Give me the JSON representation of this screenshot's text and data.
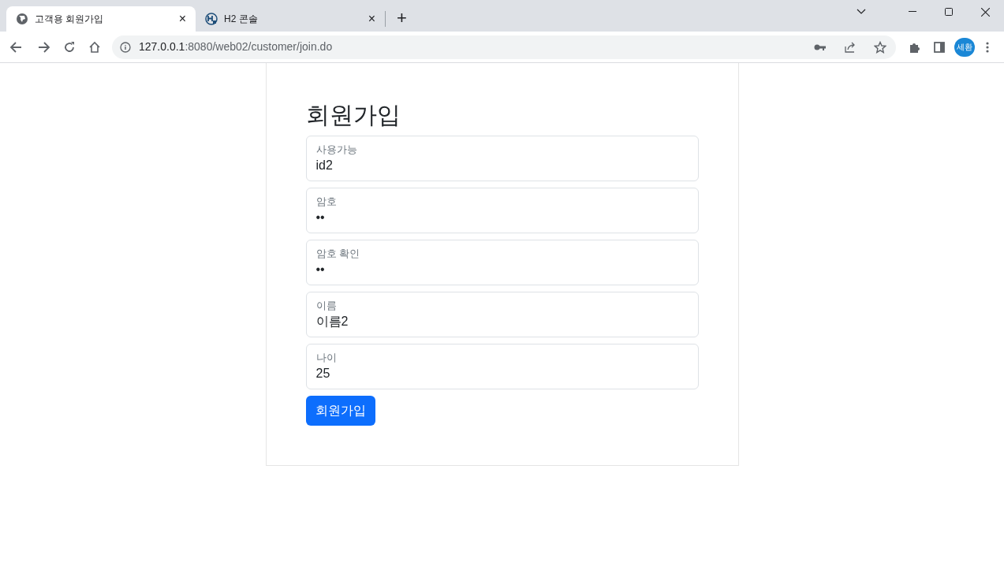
{
  "browser": {
    "tabs": [
      {
        "title": "고객용 회원가입",
        "selected": true,
        "kind": "globe",
        "close": "×"
      },
      {
        "title": "H2 콘솔",
        "selected": false,
        "kind": "h2",
        "close": "×"
      }
    ],
    "new_tab": "+",
    "address": {
      "host": "127.0.0.1",
      "path": ":8080/web02/customer/join.do"
    },
    "profile": "세환"
  },
  "form": {
    "title": "회원가입",
    "fields": [
      {
        "label": "사용가능",
        "value": "id2"
      },
      {
        "label": "암호",
        "value": "••"
      },
      {
        "label": "암호 확인",
        "value": "••"
      },
      {
        "label": "이름",
        "value": "이름2"
      },
      {
        "label": "나이",
        "value": "25"
      }
    ],
    "submit": "회원가입"
  }
}
